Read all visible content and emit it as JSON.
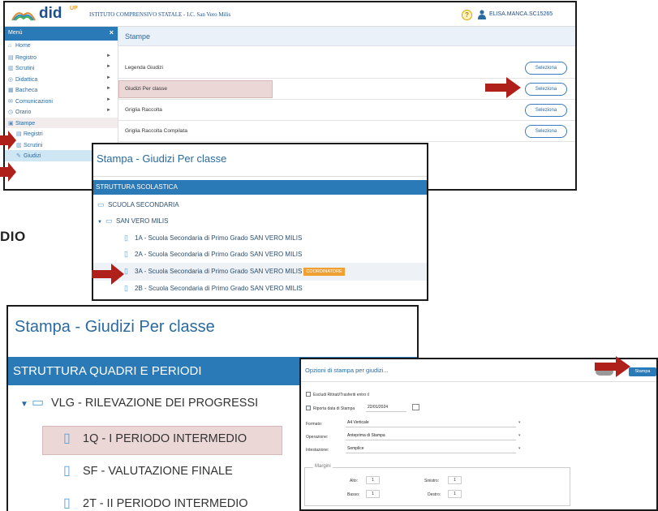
{
  "shot1": {
    "logo": "did",
    "logo_sup": "UP",
    "school": "ISTITUTO COMPRENSIVO STATALE - I.C. San Vero Milis",
    "help": "?",
    "user": "ELISA.MANCA.SC15265",
    "menu_title": "Menù",
    "menu_close": "×",
    "menu": [
      {
        "label": "Home",
        "icon": "⌂"
      },
      {
        "label": "Registro",
        "icon": "▤"
      },
      {
        "label": "Scrutini",
        "icon": "▥"
      },
      {
        "label": "Didattica",
        "icon": "◎"
      },
      {
        "label": "Bacheca",
        "icon": "▦"
      },
      {
        "label": "Comunicazioni",
        "icon": "✉"
      },
      {
        "label": "Orario",
        "icon": "◷"
      },
      {
        "label": "Stampe",
        "icon": "▣"
      },
      {
        "label": "Registri",
        "icon": "▤"
      },
      {
        "label": "Scrutini",
        "icon": "▥"
      },
      {
        "label": "Giudizi",
        "icon": "✎"
      }
    ],
    "content_title": "Stampe",
    "rows": [
      {
        "label": "Legenda Giudizi",
        "button": "Seleziona"
      },
      {
        "label": "Giudizi Per classe",
        "button": "Seleziona"
      },
      {
        "label": "Griglia Raccolta",
        "button": "Seleziona"
      },
      {
        "label": "Griglia Raccolta Compilata",
        "button": "Seleziona"
      }
    ]
  },
  "bg_text": "DIO",
  "shot2": {
    "title": "Stampa - Giudizi Per classe",
    "bar": "STRUTTURA SCOLASTICA",
    "nodes": [
      {
        "label": "SCUOLA SECONDARIA",
        "icon": "folder"
      },
      {
        "label": "SAN VERO MILIS",
        "icon": "folder-open"
      },
      {
        "label": "1A - Scuola Secondaria di Primo Grado SAN VERO MILIS",
        "icon": "file"
      },
      {
        "label": "2A - Scuola Secondaria di Primo Grado SAN VERO MILIS",
        "icon": "file"
      },
      {
        "label": "3A - Scuola Secondaria di Primo Grado SAN VERO MILIS",
        "icon": "file"
      },
      {
        "label": "2B - Scuola Secondaria di Primo Grado SAN VERO MILIS",
        "icon": "file"
      }
    ],
    "badge": "COORDINATORE"
  },
  "shot3": {
    "title": "Stampa - Giudizi Per classe",
    "bar": "STRUTTURA QUADRI E PERIODI",
    "nodes": [
      {
        "label": "VLG - RILEVAZIONE DEI PROGRESSI",
        "icon": "folder-open"
      },
      {
        "label": "1Q - I PERIODO INTERMEDIO",
        "icon": "file"
      },
      {
        "label": "SF - VALUTAZIONE FINALE",
        "icon": "file"
      },
      {
        "label": "2T - II PERIODO INTERMEDIO",
        "icon": "file"
      }
    ]
  },
  "shot4": {
    "title": "Opzioni di stampa per giudizi...",
    "stampa_button": "Stampa",
    "escludi_label": "Escludi Ritirati/Trasferiti entro il",
    "riporta_label": "Riporta data di Stampa",
    "date_value": "22/01/2024",
    "formato_label": "Formato:",
    "formato_value": "A4 Verticale",
    "operazione_label": "Operazione:",
    "operazione_value": "Anteprima di Stampa",
    "intestazione_label": "Intestazione:",
    "intestazione_value": "Semplice",
    "margini_label": "Margini",
    "alto_label": "Alto:",
    "alto_value": "1",
    "basso_label": "Basso:",
    "basso_value": "1",
    "sinistro_label": "Sinistro:",
    "sinistro_value": "1",
    "destro_label": "Destro:",
    "destro_value": "1"
  },
  "colors": {
    "accent": "#2b7ab8",
    "arrow": "#b0201a",
    "highlight": "#ecd7d7",
    "badge": "#f0a030"
  }
}
